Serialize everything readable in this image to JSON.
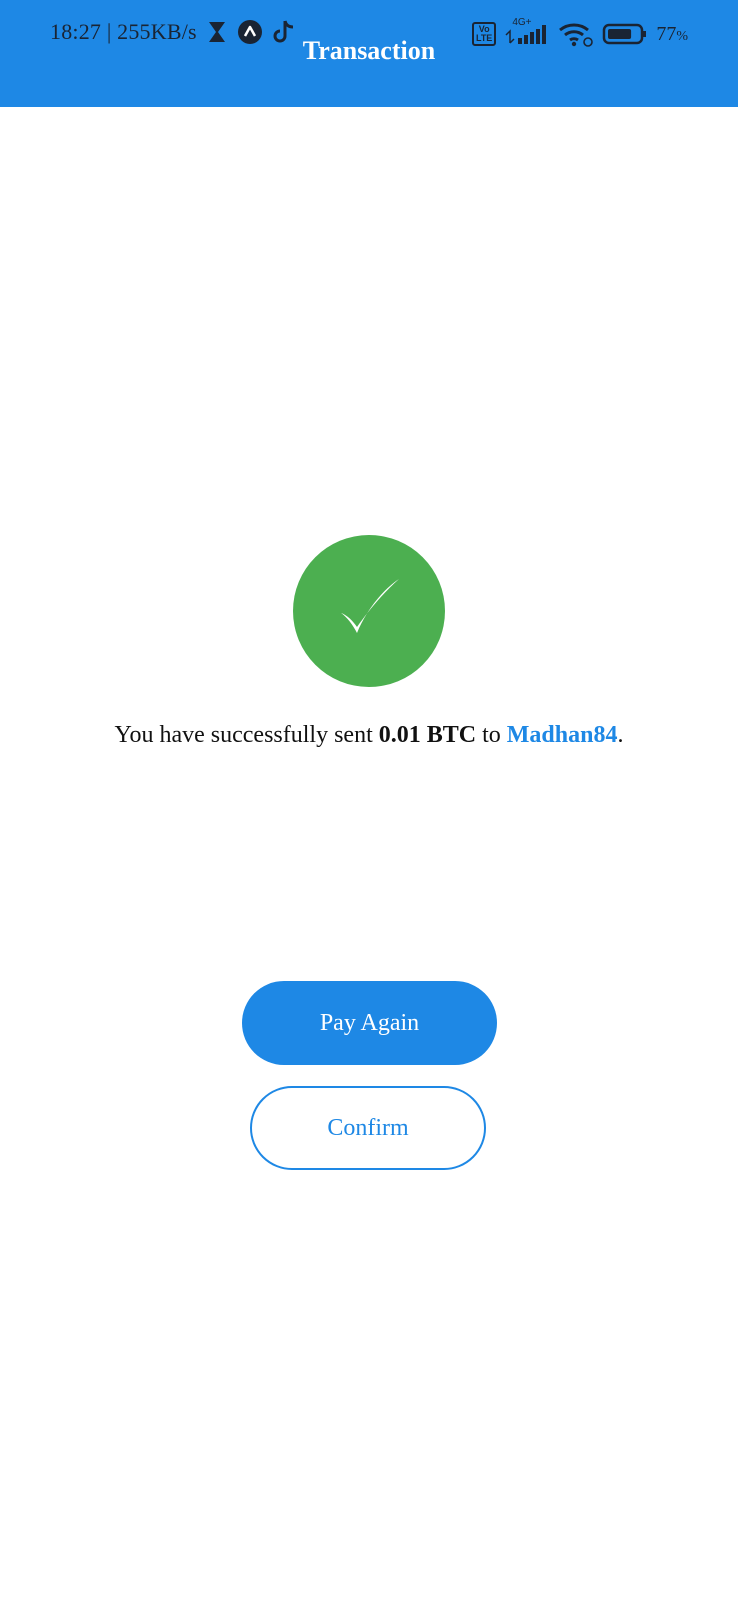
{
  "status_bar": {
    "time": "18:27",
    "separator": "|",
    "network_speed": "255KB/s",
    "left_icons": [
      "hourglass-icon",
      "navigation-icon",
      "tiktok-icon"
    ],
    "volte_label_top": "Vo",
    "volte_label_bottom": "LTE",
    "network_type": "4G+",
    "battery_percent": "77",
    "battery_unit": "%",
    "battery_level": 0.77
  },
  "header": {
    "title": "Transaction",
    "background_color": "#1e88e5"
  },
  "success": {
    "icon": "checkmark-icon",
    "circle_color": "#4caf50",
    "checkmark": "✓",
    "message_prefix": "You have successfully sent ",
    "amount": "0.01 BTC",
    "message_middle": " to ",
    "recipient": "Madhan84",
    "message_suffix": "."
  },
  "actions": {
    "pay_again_label": "Pay Again",
    "confirm_label": "Confirm",
    "accent_color": "#1e88e5"
  }
}
